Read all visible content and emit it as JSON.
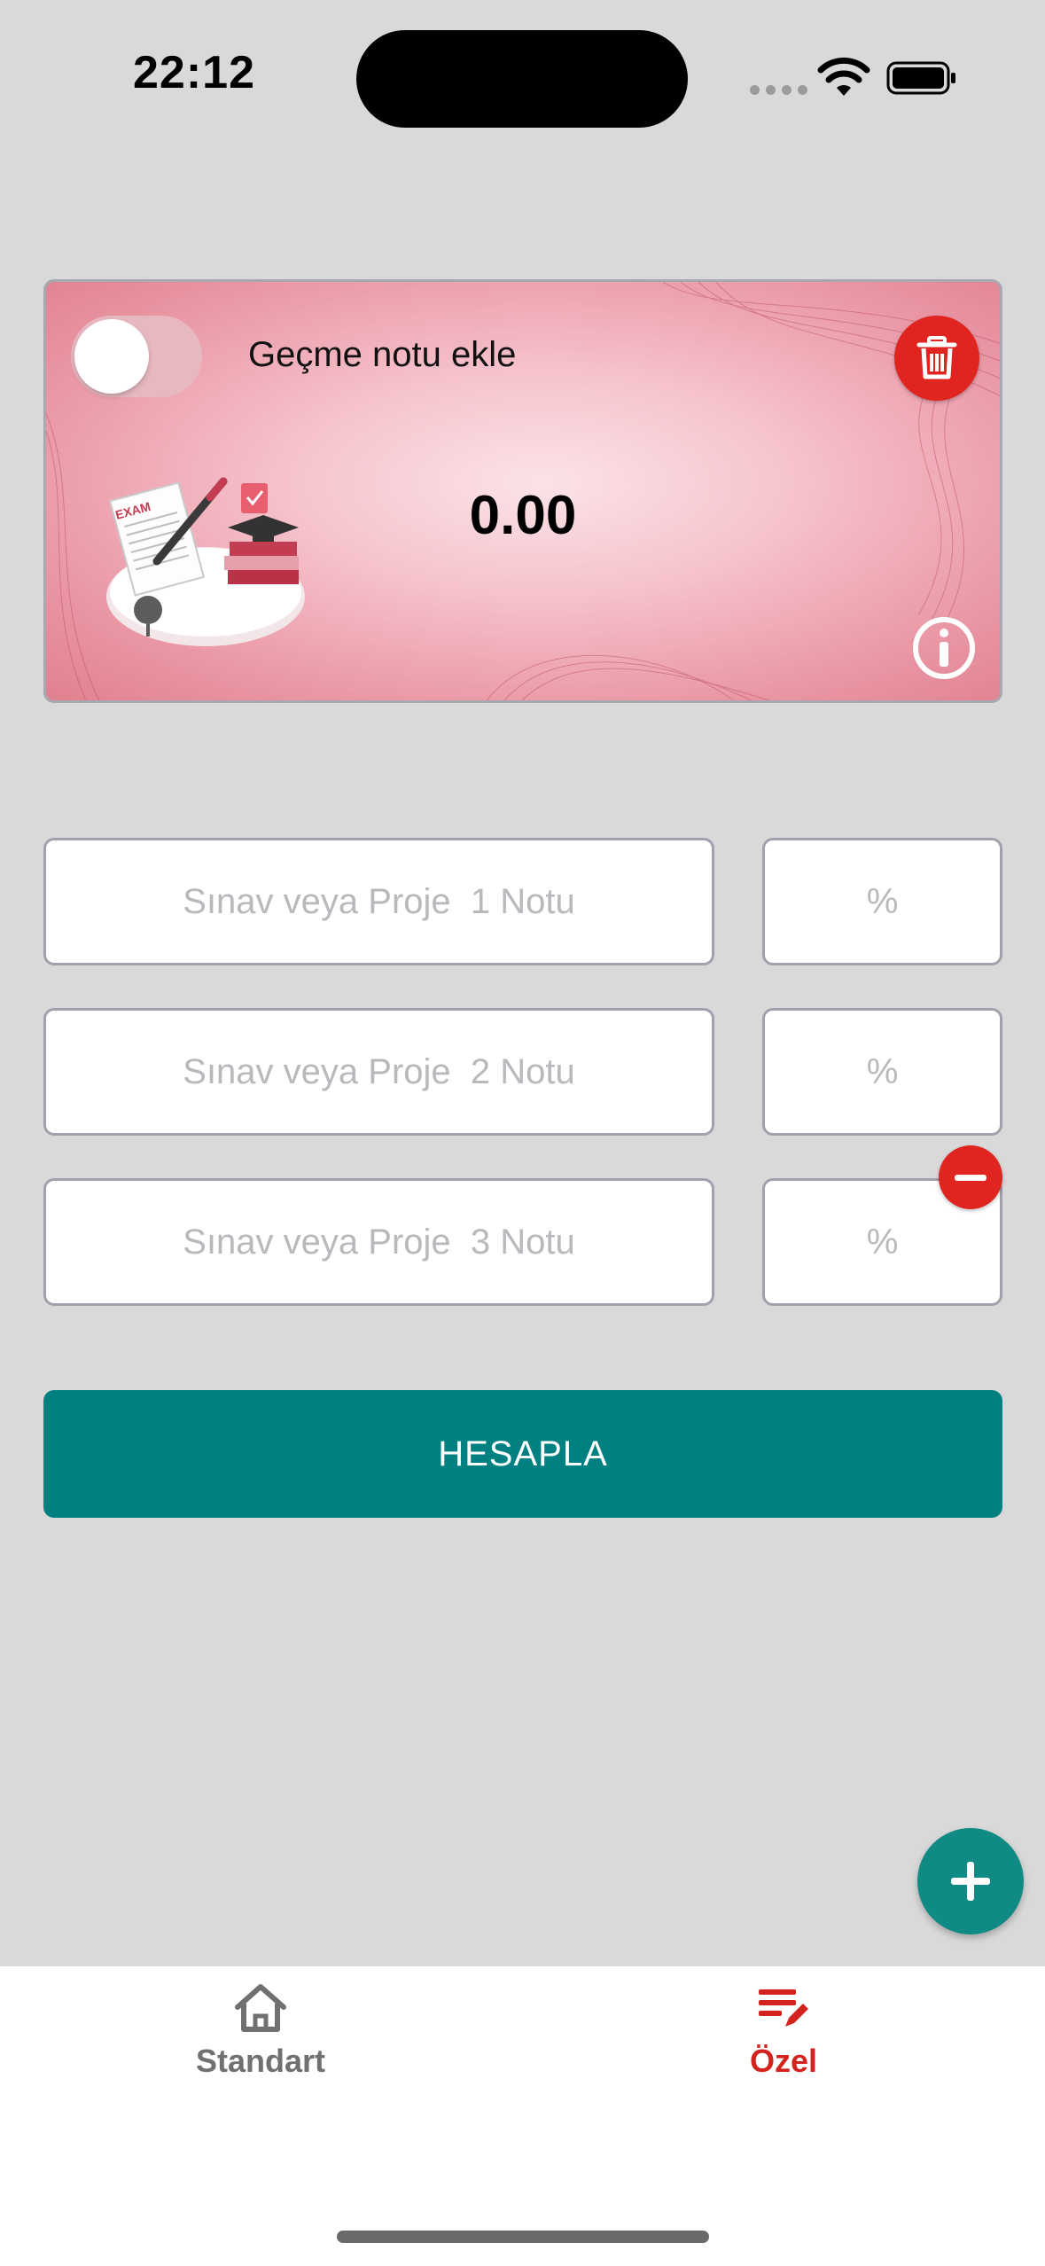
{
  "status_bar": {
    "time": "22:12"
  },
  "card": {
    "toggle_label": "Geçme notu ekle",
    "toggle_on": false,
    "result": "0.00",
    "illustration_text": "EXAM"
  },
  "rows": [
    {
      "grade_placeholder": "Sınav veya Proje  1 Notu",
      "percent_placeholder": "%"
    },
    {
      "grade_placeholder": "Sınav veya Proje  2 Notu",
      "percent_placeholder": "%"
    },
    {
      "grade_placeholder": "Sınav veya Proje  3 Notu",
      "percent_placeholder": "%"
    }
  ],
  "calculate_button": "HESAPLA",
  "tabs": [
    {
      "label": "Standart",
      "icon": "home-icon",
      "active": false
    },
    {
      "label": "Özel",
      "icon": "edit-list-icon",
      "active": true
    }
  ],
  "colors": {
    "accent_teal": "#008080",
    "danger_red": "#e0241f",
    "active_tab": "#d2231f",
    "inactive_tab": "#707070",
    "background": "#d9d9d9"
  }
}
